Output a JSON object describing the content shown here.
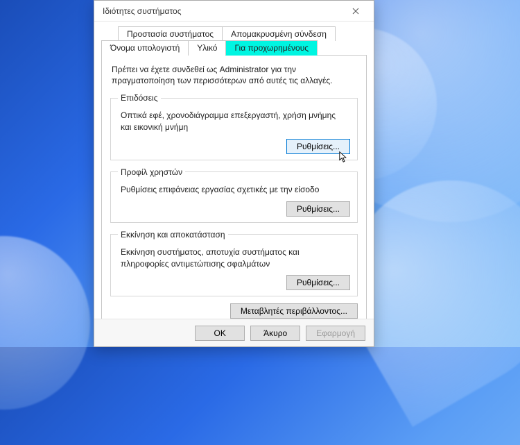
{
  "window": {
    "title": "Ιδιότητες συστήματος"
  },
  "tabs": {
    "top": [
      {
        "label": "Προστασία συστήματος"
      },
      {
        "label": "Απομακρυσμένη σύνδεση"
      }
    ],
    "bottom": [
      {
        "label": "Όνομα υπολογιστή"
      },
      {
        "label": "Υλικό"
      },
      {
        "label": "Για προχωρημένους",
        "active": true
      }
    ]
  },
  "panel": {
    "admin_note": "Πρέπει να έχετε συνδεθεί ως Administrator για την πραγματοποίηση των περισσότερων από αυτές τις αλλαγές.",
    "performance": {
      "legend": "Επιδόσεις",
      "desc": "Οπτικά εφέ, χρονοδιάγραμμα επεξεργαστή, χρήση μνήμης και εικονική μνήμη",
      "button": "Ρυθμίσεις..."
    },
    "profiles": {
      "legend": "Προφίλ χρηστών",
      "desc": "Ρυθμίσεις επιφάνειας εργασίας σχετικές με την είσοδο",
      "button": "Ρυθμίσεις..."
    },
    "startup": {
      "legend": "Εκκίνηση και αποκατάσταση",
      "desc": "Εκκίνηση συστήματος, αποτυχία συστήματος και πληροφορίες αντιμετώπισης σφαλμάτων",
      "button": "Ρυθμίσεις..."
    },
    "env_button": "Μεταβλητές περιβάλλοντος..."
  },
  "footer": {
    "ok": "OK",
    "cancel": "Άκυρο",
    "apply": "Εφαρμογή"
  }
}
